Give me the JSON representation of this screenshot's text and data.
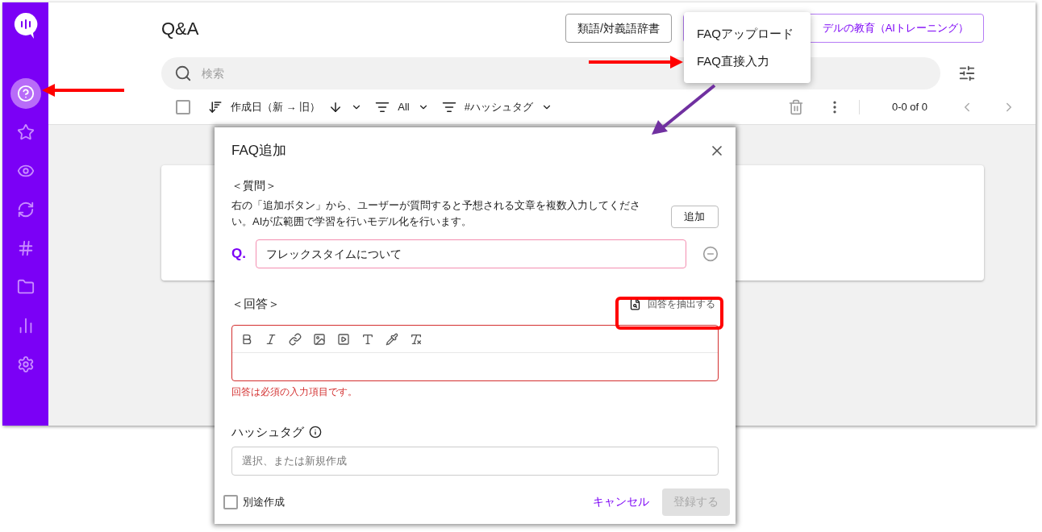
{
  "sidebar": {
    "items": [
      {
        "selected": true
      },
      {
        "selected": false
      },
      {
        "selected": false
      },
      {
        "selected": false
      },
      {
        "selected": false
      },
      {
        "selected": false
      },
      {
        "selected": false
      },
      {
        "selected": false
      }
    ]
  },
  "header": {
    "title": "Q&A",
    "buttons": [
      {
        "label": "類語/対義語辞書",
        "kind": "outline"
      },
      {
        "label": "デルの教育（AIトレーニング）",
        "kind": "primary"
      }
    ]
  },
  "menu": {
    "items": [
      {
        "label": "FAQアップロード"
      },
      {
        "label": "FAQ直接入力"
      }
    ]
  },
  "search": {
    "placeholder": "検索"
  },
  "toolbar": {
    "select_all": {
      "checked": false
    },
    "sort": "作成日（新 → 旧）",
    "filter": "All",
    "hashtag_filter": "#ハッシュタグ",
    "pagination": "0-0 of 0"
  },
  "dialog": {
    "title": "FAQ追加",
    "question_heading": "＜質問＞",
    "question_help": "右の「追加ボタン」から、ユーザーが質問すると予想される文章を複数入力してください。AIが広範囲で学習を行いモデル化を行います。",
    "add_button": "追加",
    "q_label": "Q.",
    "questions": [
      {
        "value": "フレックスタイムについて"
      }
    ],
    "answer_heading": "＜回答＞",
    "extract_button": "回答を抽出する",
    "answer": {
      "error": true,
      "error_text": "回答は必須の入力項目です。"
    },
    "hashtag_label": "ハッシュタグ",
    "hashtag_placeholder": "選択、または新規作成",
    "separate": {
      "label": "別途作成",
      "checked": false
    },
    "cancel": "キャンセル",
    "submit": {
      "label": "登録する",
      "disabled": true
    }
  }
}
